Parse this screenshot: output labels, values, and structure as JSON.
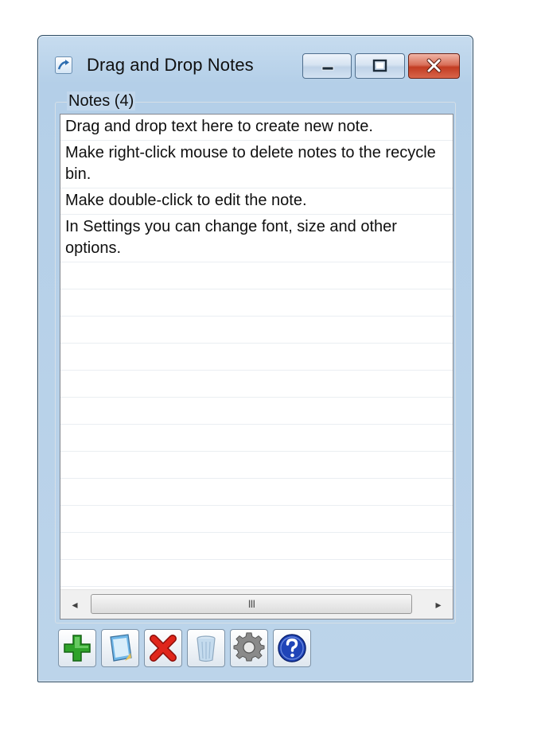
{
  "window": {
    "title": "Drag and Drop Notes"
  },
  "group": {
    "label": "Notes (4)"
  },
  "notes": [
    "Drag and drop text here to create new note.",
    "Make right-click mouse to delete notes to the recycle bin.",
    "Make double-click to edit the note.",
    "In Settings you can change font, size and other options."
  ],
  "scrollbar": {
    "left_arrow": "◂",
    "right_arrow": "▸",
    "thumb_grip": "III"
  },
  "toolbar": {
    "icons": [
      "plus-icon",
      "notepad-icon",
      "delete-x-icon",
      "recycle-bin-icon",
      "gear-icon",
      "help-icon"
    ]
  },
  "colors": {
    "frame": "#b4cfe8",
    "close_button": "#c23c22",
    "help_blue": "#1f44b8",
    "add_green": "#2fa32a",
    "delete_red": "#d8231a"
  }
}
